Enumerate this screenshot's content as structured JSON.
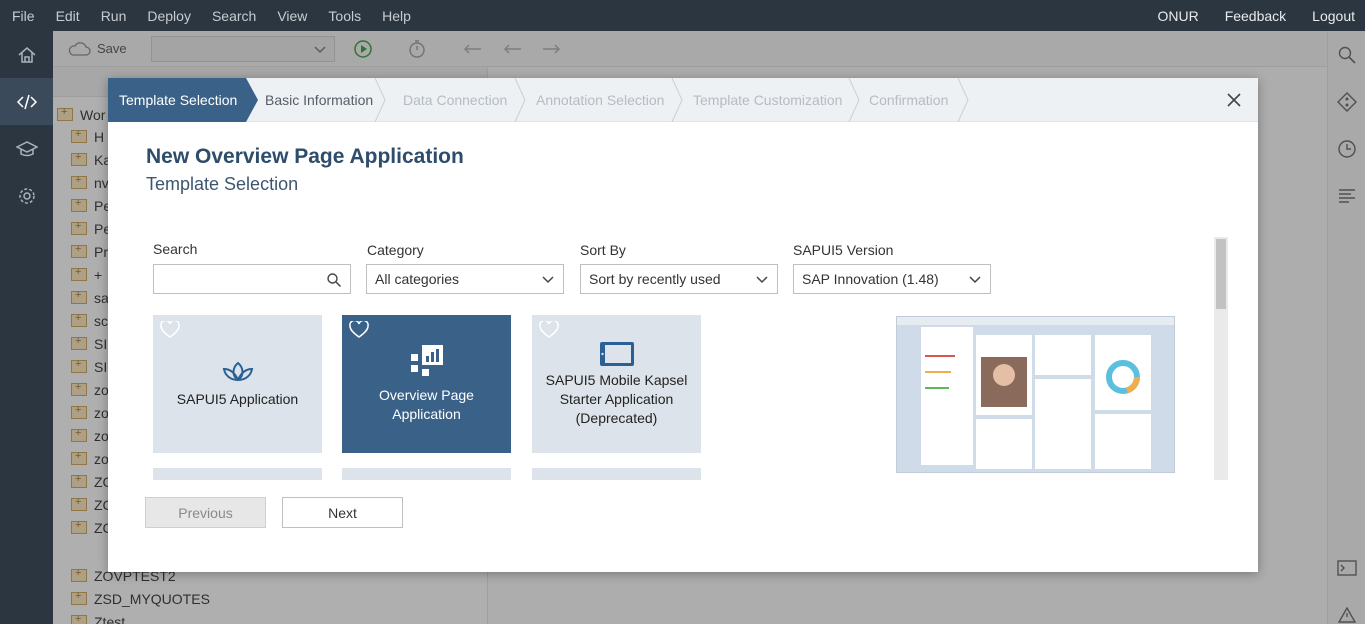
{
  "menu": [
    "File",
    "Edit",
    "Run",
    "Deploy",
    "Search",
    "View",
    "Tools",
    "Help"
  ],
  "user": {
    "name": "ONUR",
    "feedback": "Feedback",
    "logout": "Logout"
  },
  "toolbar": {
    "save_label": "Save"
  },
  "tree": {
    "root": "Wor",
    "items": [
      "H",
      "Ka",
      "nv",
      "Pe",
      "Pe",
      "Pr",
      "+",
      "sa",
      "sc",
      "SI",
      "SI",
      "zo",
      "zo",
      "zo",
      "zo",
      "ZC",
      "ZC",
      "ZC",
      "ZOVPTEST2",
      "ZSD_MYQUOTES",
      "Ztest"
    ]
  },
  "wizard": {
    "steps": [
      {
        "label": "Template Selection",
        "state": "active"
      },
      {
        "label": "Basic Information",
        "state": "done"
      },
      {
        "label": "Data Connection",
        "state": "pending"
      },
      {
        "label": "Annotation Selection",
        "state": "pending"
      },
      {
        "label": "Template Customization",
        "state": "pending"
      },
      {
        "label": "Confirmation",
        "state": "pending"
      }
    ]
  },
  "dialog": {
    "title": "New Overview Page Application",
    "subtitle": "Template Selection",
    "filters": {
      "search_label": "Search",
      "search_value": "",
      "category_label": "Category",
      "category_value": "All categories",
      "sort_label": "Sort By",
      "sort_value": "Sort by recently used",
      "version_label": "SAPUI5 Version",
      "version_value": "SAP Innovation (1.48)"
    },
    "tiles": [
      {
        "label": "SAPUI5 Application",
        "icon": "flower-icon",
        "selected": false
      },
      {
        "label": "Overview Page Application",
        "icon": "overview-chart-icon",
        "selected": true
      },
      {
        "label": "SAPUI5 Mobile Kapsel Starter Application (Deprecated)",
        "icon": "tablet-icon",
        "selected": false
      }
    ],
    "buttons": {
      "previous": "Previous",
      "next": "Next"
    }
  },
  "colors": {
    "accent": "#3a6288",
    "title": "#2e4d6b",
    "menubar": "#2b3641"
  }
}
